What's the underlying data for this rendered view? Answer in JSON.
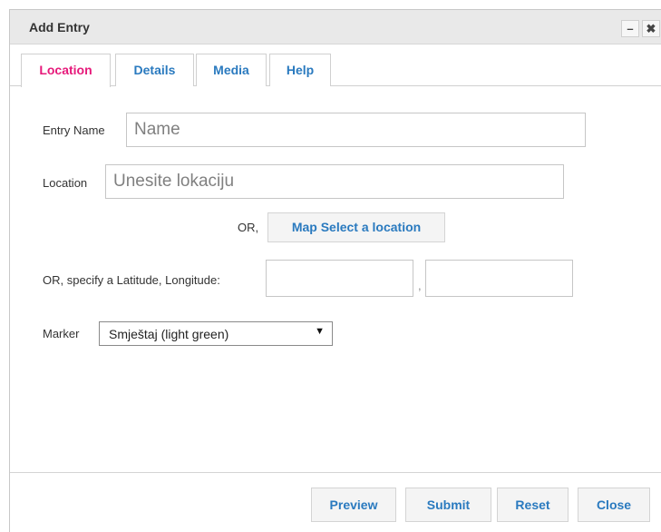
{
  "window": {
    "title": "Add Entry",
    "minimize_label": "–",
    "close_label": "✖"
  },
  "tabs": [
    {
      "label": "Location",
      "active": true
    },
    {
      "label": "Details",
      "active": false
    },
    {
      "label": "Media",
      "active": false
    },
    {
      "label": "Help",
      "active": false
    }
  ],
  "form": {
    "entry_name_label": "Entry Name",
    "entry_name_placeholder": "Name",
    "location_label": "Location",
    "location_placeholder": "Unesite lokaciju",
    "or_label": "OR,",
    "map_select_label": "Map Select a location",
    "latlng_label": "OR, specify a Latitude, Longitude:",
    "latlng_separator": ",",
    "latitude_value": "",
    "longitude_value": "",
    "marker_label": "Marker",
    "marker_selected": "Smještaj (light green)",
    "marker_arrow": "▼"
  },
  "footer": {
    "preview_label": "Preview",
    "submit_label": "Submit",
    "reset_label": "Reset",
    "close_label": "Close"
  },
  "colors": {
    "accent_link": "#2a7abf",
    "active_tab": "#e6197a",
    "titlebar_bg": "#e9e9e9"
  }
}
